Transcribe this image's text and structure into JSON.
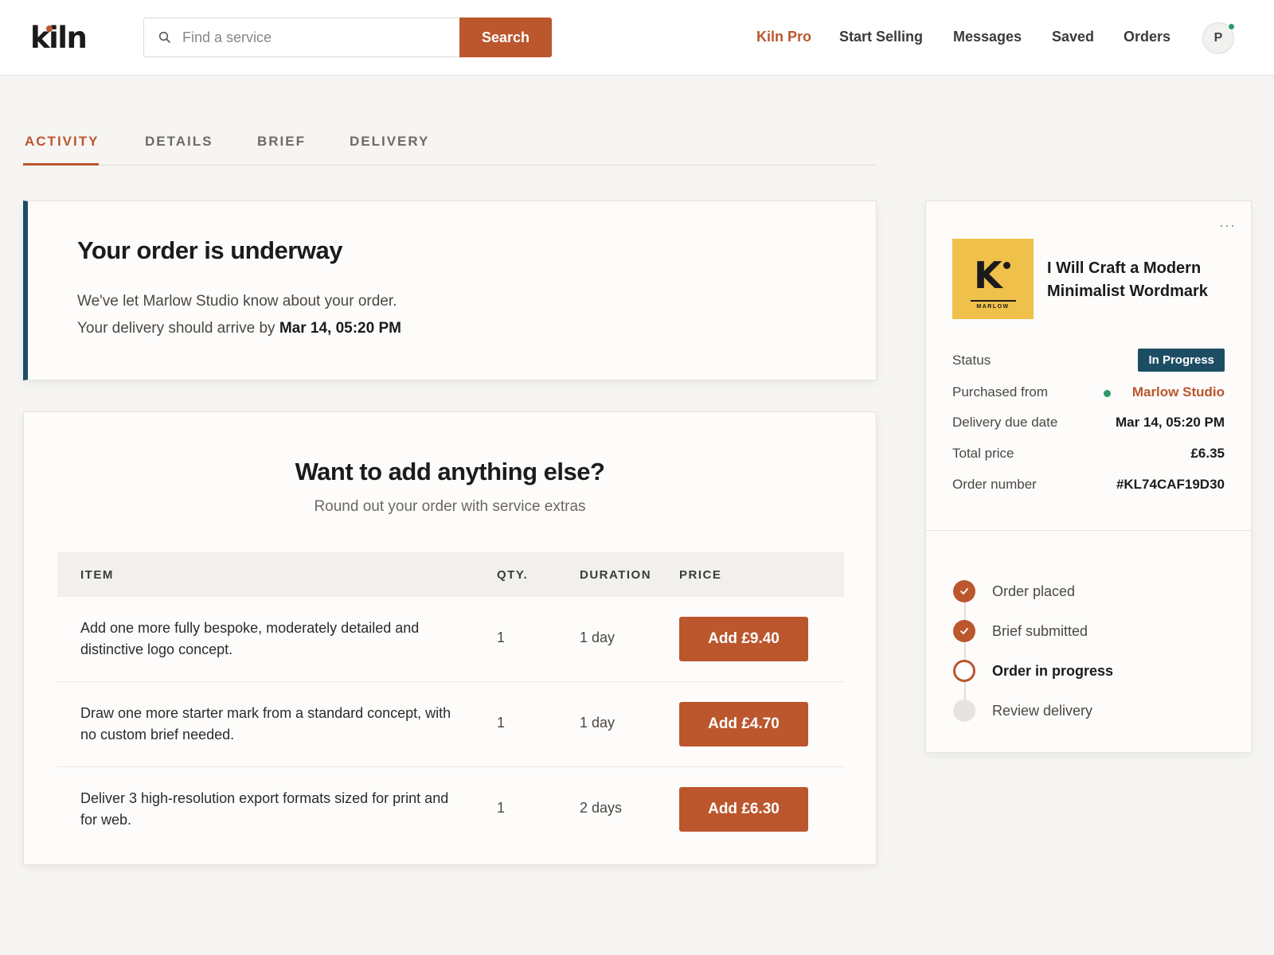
{
  "header": {
    "logo": "kiln",
    "search": {
      "placeholder": "Find a service",
      "button_label": "Search"
    },
    "nav": [
      "Kiln Pro",
      "Start Selling",
      "Messages",
      "Saved",
      "Orders"
    ],
    "avatar_initial": "P"
  },
  "tabs": [
    "ACTIVITY",
    "DETAILS",
    "BRIEF",
    "DELIVERY"
  ],
  "active_tab": "ACTIVITY",
  "underway": {
    "title": "Your order is underway",
    "line1": "We've let Marlow Studio know about your order.",
    "line2_prefix": "Your delivery should arrive by",
    "line2_date": "Mar 14, 05:20 PM"
  },
  "extras": {
    "title": "Want to add anything else?",
    "subtitle": "Round out your order with service extras",
    "columns": [
      "ITEM",
      "QTY.",
      "DURATION",
      "PRICE"
    ],
    "rows": [
      {
        "item": "Add one more fully bespoke, moderately detailed and distinctive logo concept.",
        "qty": "1",
        "duration": "1 day",
        "button": "Add £9.40"
      },
      {
        "item": "Draw one more starter mark from a standard concept, with no custom brief needed.",
        "qty": "1",
        "duration": "1 day",
        "button": "Add £4.70"
      },
      {
        "item": "Deliver 3 high-resolution export formats sized for print and for web.",
        "qty": "1",
        "duration": "2 days",
        "button": "Add £6.30"
      }
    ]
  },
  "order_summary": {
    "more": "···",
    "thumb": {
      "letter": "K",
      "brand": "MARLOW"
    },
    "service_title": "I Will Craft a Modern Minimalist Wordmark",
    "status_label": "Status",
    "status": "In Progress",
    "purchased_from_label": "Purchased from",
    "seller": "Marlow Studio",
    "due_label": "Delivery due date",
    "due": "Mar 14, 05:20 PM",
    "total_label": "Total price",
    "total": "£6.35",
    "order_number_label": "Order number",
    "order_number": "#KL74CAF19D30"
  },
  "timeline": [
    {
      "label": "Order placed",
      "state": "done"
    },
    {
      "label": "Brief submitted",
      "state": "done"
    },
    {
      "label": "Order in progress",
      "state": "current"
    },
    {
      "label": "Review delivery",
      "state": "todo"
    }
  ],
  "colors": {
    "accent": "#bb562d",
    "navy": "#1d4d63",
    "online": "#2e9a6a",
    "thumb_bg": "#efc04a"
  }
}
